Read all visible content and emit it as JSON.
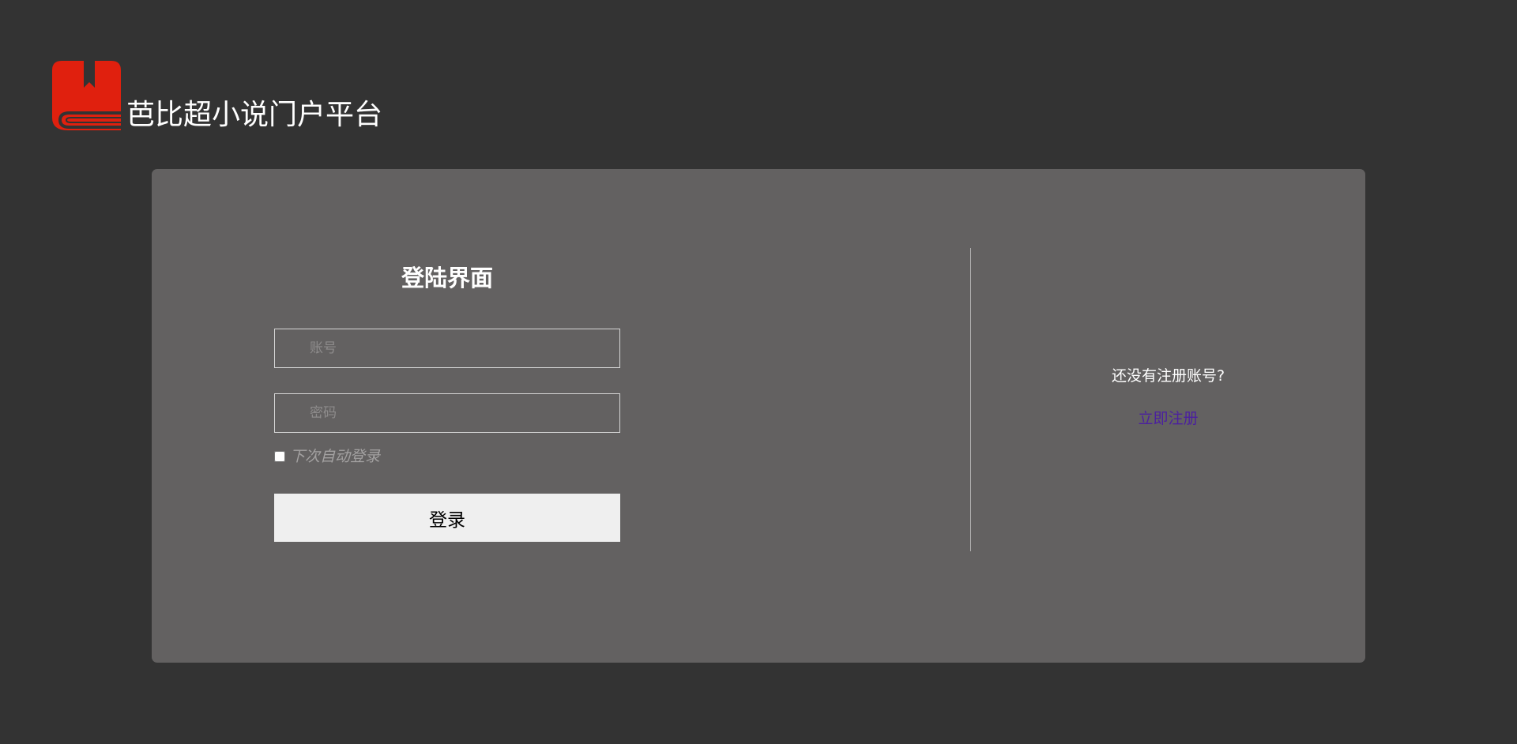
{
  "brand": {
    "title": "芭比超小说门户平台",
    "logo_icon": "book-icon",
    "logo_color": "#e0200e"
  },
  "login": {
    "heading": "登陆界面",
    "account_placeholder": "账号",
    "account_value": "",
    "password_placeholder": "密码",
    "password_value": "",
    "remember_label": "下次自动登录",
    "remember_checked": false,
    "submit_label": "登录"
  },
  "register": {
    "prompt": "还没有注册账号?",
    "link_label": "立即注册",
    "link_color": "#4b1fa0"
  },
  "colors": {
    "background": "#333333",
    "card": "#636161",
    "button": "#efefef"
  }
}
